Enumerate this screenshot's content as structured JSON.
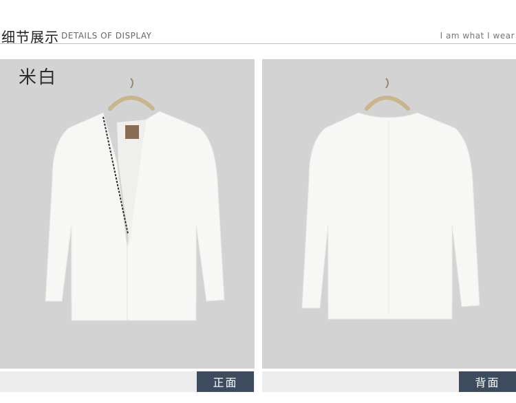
{
  "header": {
    "title_cn": "细节展示",
    "title_en": "DETAILS OF DISPLAY",
    "tagline": "I am what I wear"
  },
  "panels": [
    {
      "color_label": "米白",
      "view_label": "正面",
      "image": "jacket-front-image"
    },
    {
      "color_label": "",
      "view_label": "背面",
      "image": "jacket-back-image"
    }
  ],
  "colors": {
    "panel_bg": "#d3d3d3",
    "button_bg": "#3c4b5d",
    "jacket": "#f7f7f5"
  }
}
